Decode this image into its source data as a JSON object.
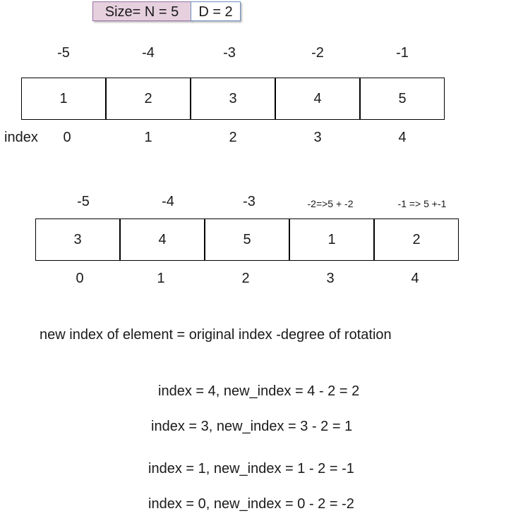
{
  "header": {
    "size_label": "Size= N = 5",
    "d_label": "D = 2"
  },
  "array1": {
    "neg_indices": [
      "-5",
      "-4",
      "-3",
      "-2",
      "-1"
    ],
    "values": [
      "1",
      "2",
      "3",
      "4",
      "5"
    ],
    "index_caption": "index",
    "indices": [
      "0",
      "1",
      "2",
      "3",
      "4"
    ]
  },
  "array2": {
    "neg_indices": [
      "-5",
      "-4",
      "-3",
      "-2=>5 + -2",
      "-1 => 5 +-1"
    ],
    "values": [
      "3",
      "4",
      "5",
      "1",
      "2"
    ],
    "indices": [
      "0",
      "1",
      "2",
      "3",
      "4"
    ]
  },
  "formula": "new index of element = original index -degree of rotation",
  "examples": [
    "index = 4, new_index = 4 - 2 = 2",
    "index = 3, new_index = 3 - 2 = 1",
    "index = 1, new_index = 1 - 2 = -1",
    "index = 0, new_index = 0 - 2 = -2"
  ],
  "colors": {
    "size_tag_fill": "#e6d0de",
    "size_tag_border": "#9673a6",
    "d_tag_border": "#6c8ebf"
  }
}
